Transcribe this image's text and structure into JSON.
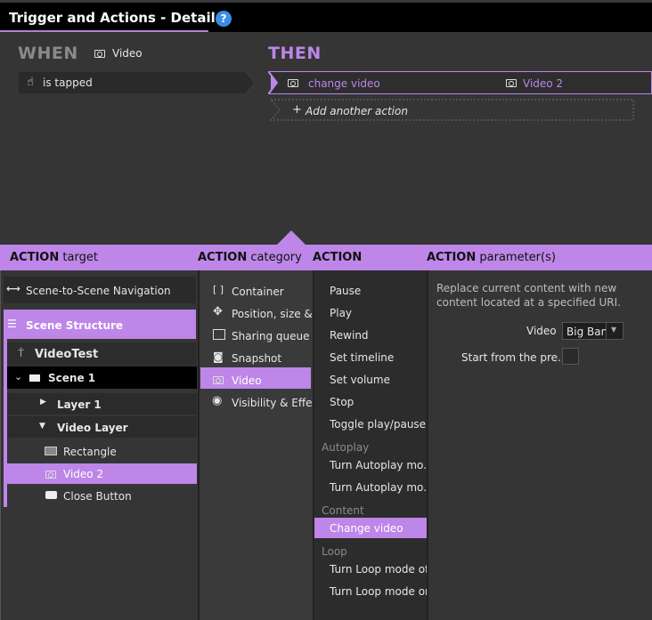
{
  "title": "Trigger and Actions - Details",
  "help_icon": "?",
  "when": {
    "label": "WHEN",
    "object": "Video",
    "trigger": "is tapped"
  },
  "then": {
    "label": "THEN",
    "action": "change video",
    "target": "Video 2",
    "add_action": "Add another action"
  },
  "headers": {
    "target_bold": "ACTION",
    "target_rest": "target",
    "category_bold": "ACTION",
    "category_rest": "category",
    "action_bold": "ACTION",
    "params_bold": "ACTION",
    "params_rest": "parameter(s)"
  },
  "targets": {
    "nav": "Scene-to-Scene Navigation",
    "structure": "Scene Structure",
    "project": "VideoTest",
    "scene": "Scene 1",
    "layer1": "Layer 1",
    "video_layer": "Video Layer",
    "rectangle": "Rectangle",
    "video2": "Video 2",
    "close_button": "Close Button"
  },
  "categories": [
    "Container",
    "Position, size &...",
    "Sharing queue",
    "Snapshot",
    "Video",
    "Visibility & Effe..."
  ],
  "actions": {
    "video": [
      "Pause",
      "Play",
      "Rewind",
      "Set timeline",
      "Set volume",
      "Stop",
      "Toggle play/pause"
    ],
    "autoplay_section": "Autoplay",
    "autoplay": [
      "Turn Autoplay mo...",
      "Turn Autoplay mo..."
    ],
    "content_section": "Content",
    "content": [
      "Change video"
    ],
    "loop_section": "Loop",
    "loop": [
      "Turn Loop mode off",
      "Turn Loop mode on"
    ]
  },
  "params": {
    "description": "Replace current content with new content located at a specified URI.",
    "video_label": "Video",
    "video_value": "Big Bang",
    "start_label": "Start from the pre..."
  },
  "colors": {
    "accent": "#bd86e8",
    "titlebar": "#000000",
    "background": "#353535"
  }
}
